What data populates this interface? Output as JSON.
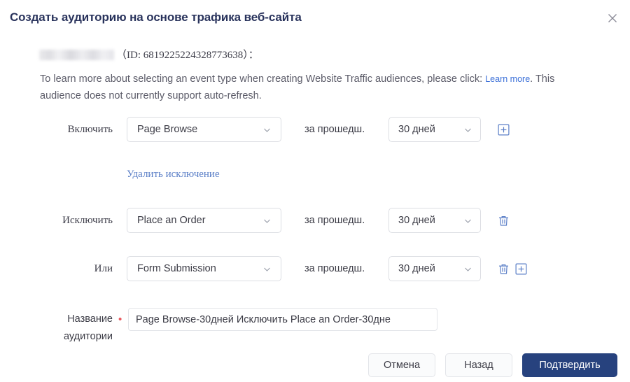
{
  "dialog": {
    "title": "Создать аудиторию на основе трафика веб-сайта",
    "close_icon": "close-icon"
  },
  "intro": {
    "id_text": "（ID: 6819225224328773638）：",
    "description_before": "To learn more about selecting an event type when creating Website Traffic audiences, please click: ",
    "link_text": "Learn more",
    "description_after": ". This audience does not currently support auto-refresh."
  },
  "rows": {
    "include": {
      "label": "Включить",
      "event": "Page Browse",
      "period_label": "за прошедш.",
      "days": "30 дней",
      "add_icon": "plus-square-icon"
    },
    "remove_exclusion_link": "Удалить исключение",
    "exclude": {
      "label": "Исключить",
      "event": "Place an Order",
      "period_label": "за прошедш.",
      "days": "30 дней",
      "delete_icon": "trash-icon"
    },
    "or": {
      "label": "Или",
      "event": "Form Submission",
      "period_label": "за прошедш.",
      "days": "30 дней",
      "delete_icon": "trash-icon",
      "add_icon": "plus-square-icon"
    }
  },
  "name_field": {
    "label_line1": "Название",
    "label_line2": "аудитории",
    "required_marker": "•",
    "value": "Page Browse-30дней Исключить Place an Order-30дне",
    "placeholder": ""
  },
  "footer": {
    "cancel_label": "Отмена",
    "back_label": "Назад",
    "confirm_label": "Подтвердить"
  },
  "colors": {
    "primary": "#27427e",
    "link": "#3a6fd8",
    "icon_blue": "#5b7fc7",
    "required_red": "#e8565c",
    "title": "#29335c"
  }
}
